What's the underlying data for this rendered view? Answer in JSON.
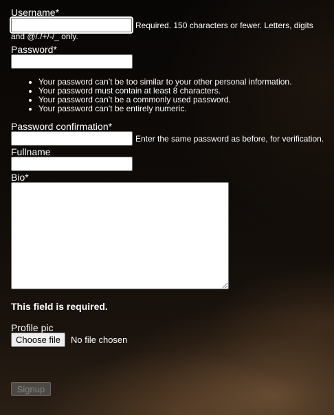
{
  "form": {
    "username": {
      "label": "Username*",
      "value": "",
      "help": "Required. 150 characters or fewer. Letters, digits and @/./+/-/_ only."
    },
    "password": {
      "label": "Password*",
      "value": "",
      "rules": [
        "Your password can’t be too similar to your other personal information.",
        "Your password must contain at least 8 characters.",
        "Your password can’t be a commonly used password.",
        "Your password can’t be entirely numeric."
      ]
    },
    "password_confirmation": {
      "label": "Password confirmation*",
      "value": "",
      "help": "Enter the same password as before, for verification."
    },
    "fullname": {
      "label": "Fullname",
      "value": ""
    },
    "bio": {
      "label": "Bio*",
      "value": "",
      "error": "This field is required."
    },
    "profile_pic": {
      "label": "Profile pic",
      "button_label": "Choose file",
      "status": "No file chosen"
    },
    "submit_label": "Signup"
  }
}
